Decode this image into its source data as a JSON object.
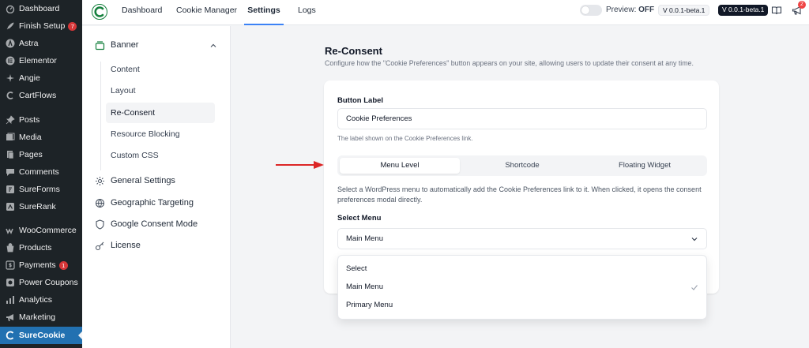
{
  "wp_menu": [
    {
      "label": "Dashboard",
      "icon": "dashboard-icon"
    },
    {
      "label": "Finish Setup",
      "icon": "rocket-icon",
      "badge": "7"
    },
    {
      "label": "Astra",
      "icon": "astra-icon"
    },
    {
      "label": "Elementor",
      "icon": "elementor-icon"
    },
    {
      "label": "Angie",
      "icon": "angie-icon"
    },
    {
      "label": "CartFlows",
      "icon": "cartflows-icon"
    },
    {
      "label": "Posts",
      "icon": "pin-icon"
    },
    {
      "label": "Media",
      "icon": "media-icon"
    },
    {
      "label": "Pages",
      "icon": "pages-icon"
    },
    {
      "label": "Comments",
      "icon": "comments-icon"
    },
    {
      "label": "SureForms",
      "icon": "sureforms-icon"
    },
    {
      "label": "SureRank",
      "icon": "surerank-icon"
    },
    {
      "label": "WooCommerce",
      "icon": "woocommerce-icon"
    },
    {
      "label": "Products",
      "icon": "products-icon"
    },
    {
      "label": "Payments",
      "icon": "payments-icon",
      "badge": "1"
    },
    {
      "label": "Power Coupons",
      "icon": "coupons-icon"
    },
    {
      "label": "Analytics",
      "icon": "analytics-icon"
    },
    {
      "label": "Marketing",
      "icon": "megaphone-icon"
    },
    {
      "label": "SureCookie",
      "icon": "surecookie-icon"
    }
  ],
  "topbar": {
    "tabs": [
      "Dashboard",
      "Cookie Manager",
      "Settings",
      "Logs"
    ],
    "active_tab": "Settings",
    "preview_label": "Preview:",
    "preview_state": "OFF",
    "version_1": "V 0.0.1-beta.1",
    "version_2": "V 0.0.1-beta.1",
    "notification_count": "2"
  },
  "settings_nav": {
    "banner": "Banner",
    "banner_subitems": [
      "Content",
      "Layout",
      "Re-Consent",
      "Resource Blocking",
      "Custom CSS"
    ],
    "active_subitem": "Re-Consent",
    "sections": [
      {
        "label": "General Settings",
        "icon": "gear-icon"
      },
      {
        "label": "Geographic Targeting",
        "icon": "globe-icon"
      },
      {
        "label": "Google Consent Mode",
        "icon": "shield-icon"
      },
      {
        "label": "License",
        "icon": "key-icon"
      }
    ]
  },
  "main": {
    "title": "Re-Consent",
    "description": "Configure how the \"Cookie Preferences\" button appears on your site, allowing users to update their consent at any time.",
    "button_label_title": "Button Label",
    "button_label_value": "Cookie Preferences",
    "button_label_help": "The label shown on the Cookie Preferences link.",
    "tabs": [
      "Menu Level",
      "Shortcode",
      "Floating Widget"
    ],
    "active_tab": "Menu Level",
    "menu_description": "Select a WordPress menu to automatically add the Cookie Preferences link to it. When clicked, it opens the consent preferences modal directly.",
    "select_menu_label": "Select Menu",
    "select_menu_value": "Main Menu",
    "options": [
      "Select",
      "Main Menu",
      "Primary Menu"
    ],
    "selected_option": "Main Menu"
  },
  "colors": {
    "wp_sidebar": "#1d2327",
    "wp_active": "#2271b1",
    "accent_tab": "#3b82f6",
    "annotation_arrow": "#dc2626",
    "brand_green": "#15803d"
  }
}
